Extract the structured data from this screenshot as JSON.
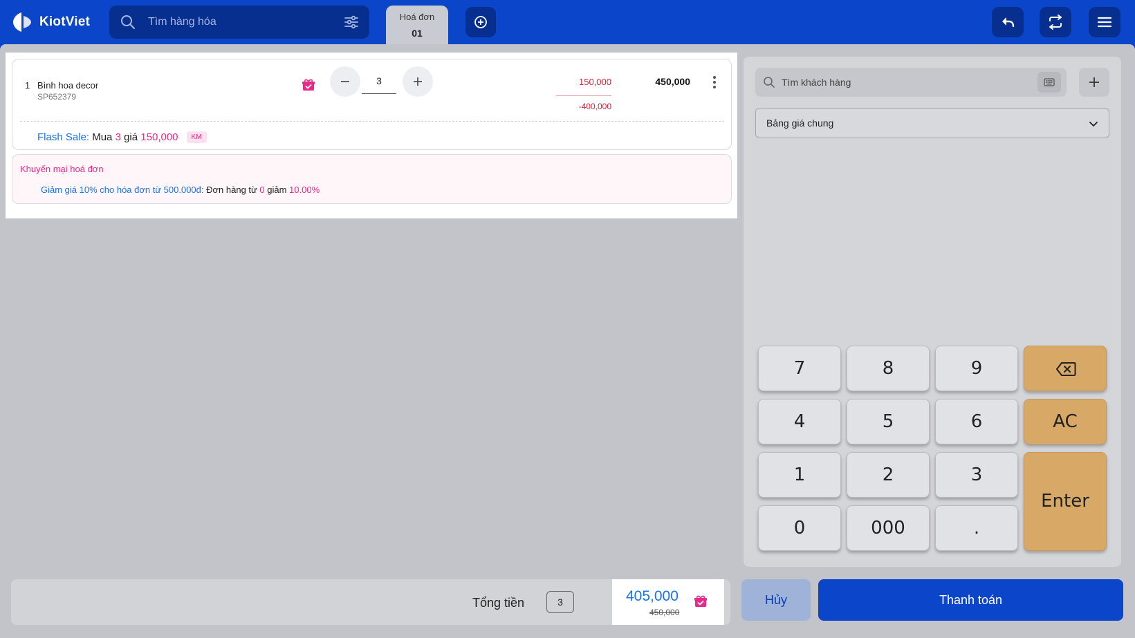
{
  "app": {
    "logo_text": "KiotViet"
  },
  "search": {
    "placeholder": "Tìm hàng hóa"
  },
  "invoice_tab": {
    "label": "Hoá đơn",
    "number": "01"
  },
  "cart": {
    "items": [
      {
        "index": "1",
        "name": "Bình hoa decor",
        "code": "SP652379",
        "quantity": "3",
        "unit_price": "150,000",
        "discount": "-400,000",
        "line_total": "450,000",
        "flash_sale": {
          "label": "Flash Sale:",
          "buy_text": "Mua",
          "buy_qty": "3",
          "price_text": "giá",
          "price": "150,000",
          "badge": "KM"
        }
      }
    ]
  },
  "invoice_promo": {
    "title": "Khuyến mại hoá đơn",
    "rule": "Giảm giá 10% cho hóa đơn từ 500.000đ:",
    "text1": "Đơn hàng từ",
    "min_value": "0",
    "text2": "giảm",
    "percent": "10.00%"
  },
  "customer": {
    "placeholder": "Tìm khách hàng"
  },
  "price_book": {
    "selected": "Bảng giá chung"
  },
  "keypad": {
    "keys": [
      "7",
      "8",
      "9",
      "4",
      "5",
      "6",
      "1",
      "2",
      "3",
      "0",
      "000",
      "."
    ],
    "clear": "AC",
    "enter": "Enter"
  },
  "footer": {
    "total_label": "Tổng tiền",
    "count": "3",
    "total": "405,000",
    "original_total": "450,000",
    "cancel_label": "Hủy",
    "pay_label": "Thanh toán"
  },
  "colors": {
    "primary": "#0b45c9",
    "dark_primary": "#072f8f",
    "accent_pink": "#e62c8a",
    "price_red": "#d4263c",
    "link_blue": "#1b74e4",
    "key_orange": "#d7a866"
  },
  "icons": [
    "kiotviet-logo-icon",
    "search-icon",
    "filter-icon",
    "add-circle-icon",
    "undo-icon",
    "sync-icon",
    "menu-icon",
    "gift-icon",
    "minus-icon",
    "plus-icon",
    "more-vertical-icon",
    "keyboard-icon",
    "chevron-down-icon",
    "backspace-icon"
  ]
}
